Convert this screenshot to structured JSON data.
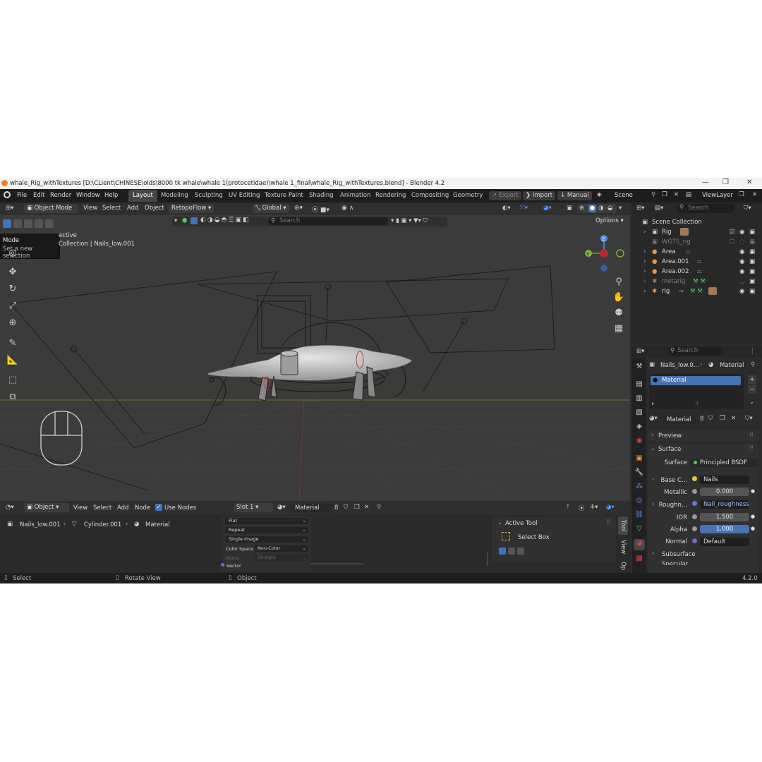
{
  "window": {
    "title": "whale_Rig_withTextures [D:\\CLient\\CHINESE\\olds\\8000 tk whale\\whale 1(protocetidae)\\whale 1_final\\whale_Rig_withTextures.blend] - Blender 4.2",
    "minimize": "—",
    "maximize": "❐",
    "close": "✕"
  },
  "menu": [
    "File",
    "Edit",
    "Render",
    "Window",
    "Help"
  ],
  "workspaces": [
    "Layout",
    "Modeling",
    "Sculpting",
    "UV Editing",
    "Texture Paint",
    "Shading",
    "Animation",
    "Rendering",
    "Compositing",
    "Geometry N"
  ],
  "topright": {
    "export": "Export",
    "import": "Import",
    "manual": "Manual",
    "scene": "Scene",
    "viewlayer": "ViewLayer"
  },
  "viewport_header": {
    "mode": "Object Mode",
    "view": "View",
    "select": "Select",
    "add": "Add",
    "object": "Object",
    "retopo": "RetopoFlow",
    "orientation": "Global",
    "search_placeholder": "Search",
    "options": "Options"
  },
  "tooltip": {
    "title": "Mode",
    "desc": "Set a new selection"
  },
  "viewport_overlay": {
    "line1": "ective",
    "collection": "Collection",
    "object": "Nails_low.001"
  },
  "gizmo": {
    "z": "Z",
    "y": "Y"
  },
  "outliner": {
    "search_placeholder": "Search",
    "root": "Scene Collection",
    "items": [
      {
        "name": "Rig",
        "muted": false
      },
      {
        "name": "WGTS_rig",
        "muted": true
      },
      {
        "name": "Area",
        "muted": false
      },
      {
        "name": "Area.001",
        "muted": false
      },
      {
        "name": "Area.002",
        "muted": false
      },
      {
        "name": "metarig",
        "muted": true
      },
      {
        "name": "rig",
        "muted": false
      }
    ]
  },
  "properties": {
    "search_placeholder": "Search",
    "breadcrumb_object": "Nails_low.0...",
    "breadcrumb_material": "Material",
    "slot_material": "Material",
    "datablock": "Material",
    "users": "8",
    "preview": "Preview",
    "surface_panel": "Surface",
    "rows": [
      {
        "label": "Surface",
        "value": "Principled BSDF",
        "kind": "link",
        "dot": "#5ec46a"
      },
      {
        "label": "Base C...",
        "value": "Nails",
        "kind": "link",
        "dot": "#e3c842"
      },
      {
        "label": "Metallic",
        "value": "0.000",
        "kind": "num",
        "dot": "#9a9a9a"
      },
      {
        "label": "Roughn...",
        "value": "Nail_roughness",
        "kind": "link",
        "dot": "#5a7fcf"
      },
      {
        "label": "IOR",
        "value": "1.500",
        "kind": "num",
        "dot": "#9a9a9a"
      },
      {
        "label": "Alpha",
        "value": "1.000",
        "kind": "numfull",
        "dot": "#9a9a9a"
      },
      {
        "label": "Normal",
        "value": "Default",
        "kind": "link",
        "dot": "#6a6ad0"
      }
    ],
    "subsurface": "Subsurface",
    "specular": "Specular"
  },
  "shader_header": {
    "object": "Object",
    "view": "View",
    "select": "Select",
    "add": "Add",
    "node": "Node",
    "use_nodes": "Use Nodes",
    "slot": "Slot 1",
    "material": "Material",
    "users": "8"
  },
  "shader_breadcrumb": [
    "Nails_low.001",
    "Cylinder.001",
    "Material"
  ],
  "image_node": {
    "interp": "Flat",
    "extension": "Repeat",
    "source": "Single Image",
    "colorspace_label": "Color Space",
    "colorspace": "Non-Color",
    "alpha_label": "Alpha",
    "alpha": "Straight",
    "vector": "Vector"
  },
  "tool_panel": {
    "header": "Active Tool",
    "tool": "Select Box",
    "tabs": [
      "Tool",
      "View",
      "Op"
    ]
  },
  "status": {
    "select": "Select",
    "rotate": "Rotate View",
    "object": "Object",
    "version": "4.2.0"
  }
}
